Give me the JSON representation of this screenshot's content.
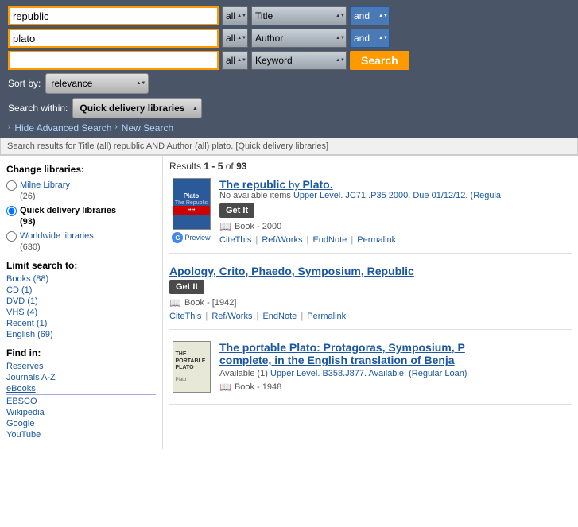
{
  "search": {
    "row1": {
      "text_value": "republic",
      "all_option": "all",
      "type_option": "Title",
      "bool_option": "and"
    },
    "row2": {
      "text_value": "plato",
      "all_option": "all",
      "type_option": "Author",
      "bool_option": "and"
    },
    "row3": {
      "text_value": "",
      "all_option": "all",
      "type_option": "Keyword",
      "bool_option": ""
    },
    "search_button": "Search",
    "sort_label": "Sort by:",
    "sort_value": "relevance",
    "search_within_label": "Search within:",
    "search_within_value": "Quick delivery libraries",
    "hide_advanced": "Hide Advanced Search",
    "new_search": "New Search"
  },
  "results_bar": {
    "text": "Search results for Title (all) republic AND Author (all) plato. [Quick delivery libraries]"
  },
  "sidebar": {
    "change_libraries_title": "Change libraries:",
    "libraries": [
      {
        "name": "Milne Library",
        "count": "(26)",
        "selected": false
      },
      {
        "name": "Quick delivery libraries",
        "count": "(93)",
        "selected": true
      },
      {
        "name": "Worldwide libraries",
        "count": "(630)",
        "selected": false
      }
    ],
    "limit_title": "Limit search to:",
    "limits": [
      "Books (88)",
      "CD (1)",
      "DVD (1)",
      "VHS (4)",
      "Recent (1)",
      "English (69)"
    ],
    "find_in_title": "Find in:",
    "find_in_items": [
      "Reserves",
      "Journals A-Z",
      "eBooks",
      "EBSCO",
      "Wikipedia",
      "Google",
      "YouTube"
    ]
  },
  "results": {
    "count_text": "Results",
    "range": "1 - 5",
    "of": "of",
    "total": "93",
    "items": [
      {
        "id": 1,
        "title": "The republic",
        "author_prefix": "by",
        "author": "Plato.",
        "availability_text": "No available items",
        "availability_detail": "Upper Level. JC71 .P35 2000. Due 01/12/12. (Regula",
        "format": "Book",
        "year": "2000",
        "has_cover": true,
        "has_google_preview": true,
        "actions": [
          "CiteThis",
          "Ref/Works",
          "EndNote",
          "Permalink"
        ]
      },
      {
        "id": 2,
        "title": "Apology, Crito, Phaedo, Symposium, Republic",
        "author_prefix": "",
        "author": "",
        "availability_text": "",
        "availability_detail": "",
        "format": "Book",
        "year": "[1942]",
        "has_cover": false,
        "has_google_preview": false,
        "actions": [
          "CiteThis",
          "Ref/Works",
          "EndNote",
          "Permalink"
        ]
      },
      {
        "id": 3,
        "title": "The portable Plato: Protagoras, Symposium, P",
        "title_cont": "complete, in the English translation of Benja",
        "availability_text": "Available (1)",
        "availability_detail": "Upper Level. B358.J877. Available. (Regular Loan)",
        "format": "Book",
        "year": "1948",
        "has_cover": true,
        "has_google_preview": false,
        "actions": []
      }
    ]
  }
}
